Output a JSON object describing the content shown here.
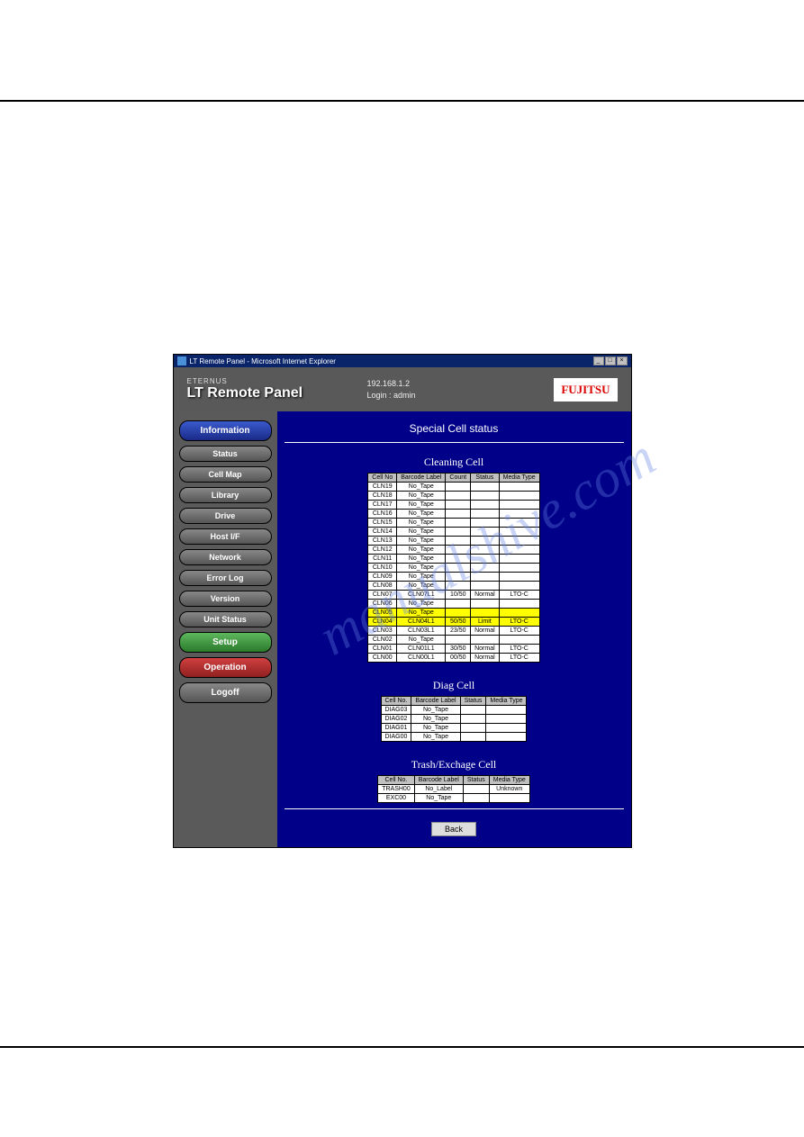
{
  "titlebar": {
    "text": "LT Remote Panel - Microsoft Internet Explorer"
  },
  "header": {
    "brand_sub": "ETERNUS",
    "brand": "LT Remote Panel",
    "ip": "192.168.1.2",
    "login": "Login : admin",
    "logo": "FUJITSU"
  },
  "sidebar": {
    "items": [
      {
        "label": "Information",
        "style": "nav-blue nav-blue-big"
      },
      {
        "label": "Status",
        "style": "nav-grey"
      },
      {
        "label": "Cell Map",
        "style": "nav-grey"
      },
      {
        "label": "Library",
        "style": "nav-grey"
      },
      {
        "label": "Drive",
        "style": "nav-grey"
      },
      {
        "label": "Host I/F",
        "style": "nav-grey"
      },
      {
        "label": "Network",
        "style": "nav-grey"
      },
      {
        "label": "Error Log",
        "style": "nav-grey"
      },
      {
        "label": "Version",
        "style": "nav-grey"
      },
      {
        "label": "Unit Status",
        "style": "nav-grey"
      },
      {
        "label": "Setup",
        "style": "nav-green"
      },
      {
        "label": "Operation",
        "style": "nav-red"
      },
      {
        "label": "Logoff",
        "style": "nav-grey nav-grey-big"
      }
    ]
  },
  "content": {
    "page_title": "Special Cell status",
    "cleaning": {
      "title": "Cleaning Cell",
      "headers": [
        "Cell No",
        "Barcode Label",
        "Count",
        "Status",
        "Media Type"
      ],
      "rows": [
        {
          "c": [
            "CLN19",
            "No_Tape",
            "",
            "",
            ""
          ],
          "hl": false
        },
        {
          "c": [
            "CLN18",
            "No_Tape",
            "",
            "",
            ""
          ],
          "hl": false
        },
        {
          "c": [
            "CLN17",
            "No_Tape",
            "",
            "",
            ""
          ],
          "hl": false
        },
        {
          "c": [
            "CLN16",
            "No_Tape",
            "",
            "",
            ""
          ],
          "hl": false
        },
        {
          "c": [
            "CLN15",
            "No_Tape",
            "",
            "",
            ""
          ],
          "hl": false
        },
        {
          "c": [
            "CLN14",
            "No_Tape",
            "",
            "",
            ""
          ],
          "hl": false
        },
        {
          "c": [
            "CLN13",
            "No_Tape",
            "",
            "",
            ""
          ],
          "hl": false
        },
        {
          "c": [
            "CLN12",
            "No_Tape",
            "",
            "",
            ""
          ],
          "hl": false
        },
        {
          "c": [
            "CLN11",
            "No_Tape",
            "",
            "",
            ""
          ],
          "hl": false
        },
        {
          "c": [
            "CLN10",
            "No_Tape",
            "",
            "",
            ""
          ],
          "hl": false
        },
        {
          "c": [
            "CLN09",
            "No_Tape",
            "",
            "",
            ""
          ],
          "hl": false
        },
        {
          "c": [
            "CLN08",
            "No_Tape",
            "",
            "",
            ""
          ],
          "hl": false
        },
        {
          "c": [
            "CLN07",
            "CLN07L1",
            "10/50",
            "Normal",
            "LTO-C"
          ],
          "hl": false
        },
        {
          "c": [
            "CLN06",
            "No_Tape",
            "",
            "",
            ""
          ],
          "hl": false
        },
        {
          "c": [
            "CLN05",
            "No_Tape",
            "",
            "",
            ""
          ],
          "hl": true
        },
        {
          "c": [
            "CLN04",
            "CLN04L1",
            "50/50",
            "Limit",
            "LTO-C"
          ],
          "hl": true
        },
        {
          "c": [
            "CLN03",
            "CLN03L1",
            "23/50",
            "Normal",
            "LTO-C"
          ],
          "hl": false
        },
        {
          "c": [
            "CLN02",
            "No_Tape",
            "",
            "",
            ""
          ],
          "hl": false
        },
        {
          "c": [
            "CLN01",
            "CLN01L1",
            "30/50",
            "Normal",
            "LTO-C"
          ],
          "hl": false
        },
        {
          "c": [
            "CLN00",
            "CLN00L1",
            "00/50",
            "Normal",
            "LTO-C"
          ],
          "hl": false
        }
      ]
    },
    "diag": {
      "title": "Diag Cell",
      "headers": [
        "Cell No.",
        "Barcode Label",
        "Status",
        "Media Type"
      ],
      "rows": [
        {
          "c": [
            "DIAG03",
            "No_Tape",
            "",
            ""
          ]
        },
        {
          "c": [
            "DIAG02",
            "No_Tape",
            "",
            ""
          ]
        },
        {
          "c": [
            "DIAG01",
            "No_Tape",
            "",
            ""
          ]
        },
        {
          "c": [
            "DIAG00",
            "No_Tape",
            "",
            ""
          ]
        }
      ]
    },
    "trash": {
      "title": "Trash/Exchage Cell",
      "headers": [
        "Cell No.",
        "Barcode Label",
        "Status",
        "Media Type"
      ],
      "rows": [
        {
          "c": [
            "TRASH00",
            "No_Label",
            "",
            "Unknown"
          ]
        },
        {
          "c": [
            "EXC00",
            "No_Tape",
            "",
            ""
          ]
        }
      ]
    },
    "back": "Back"
  }
}
